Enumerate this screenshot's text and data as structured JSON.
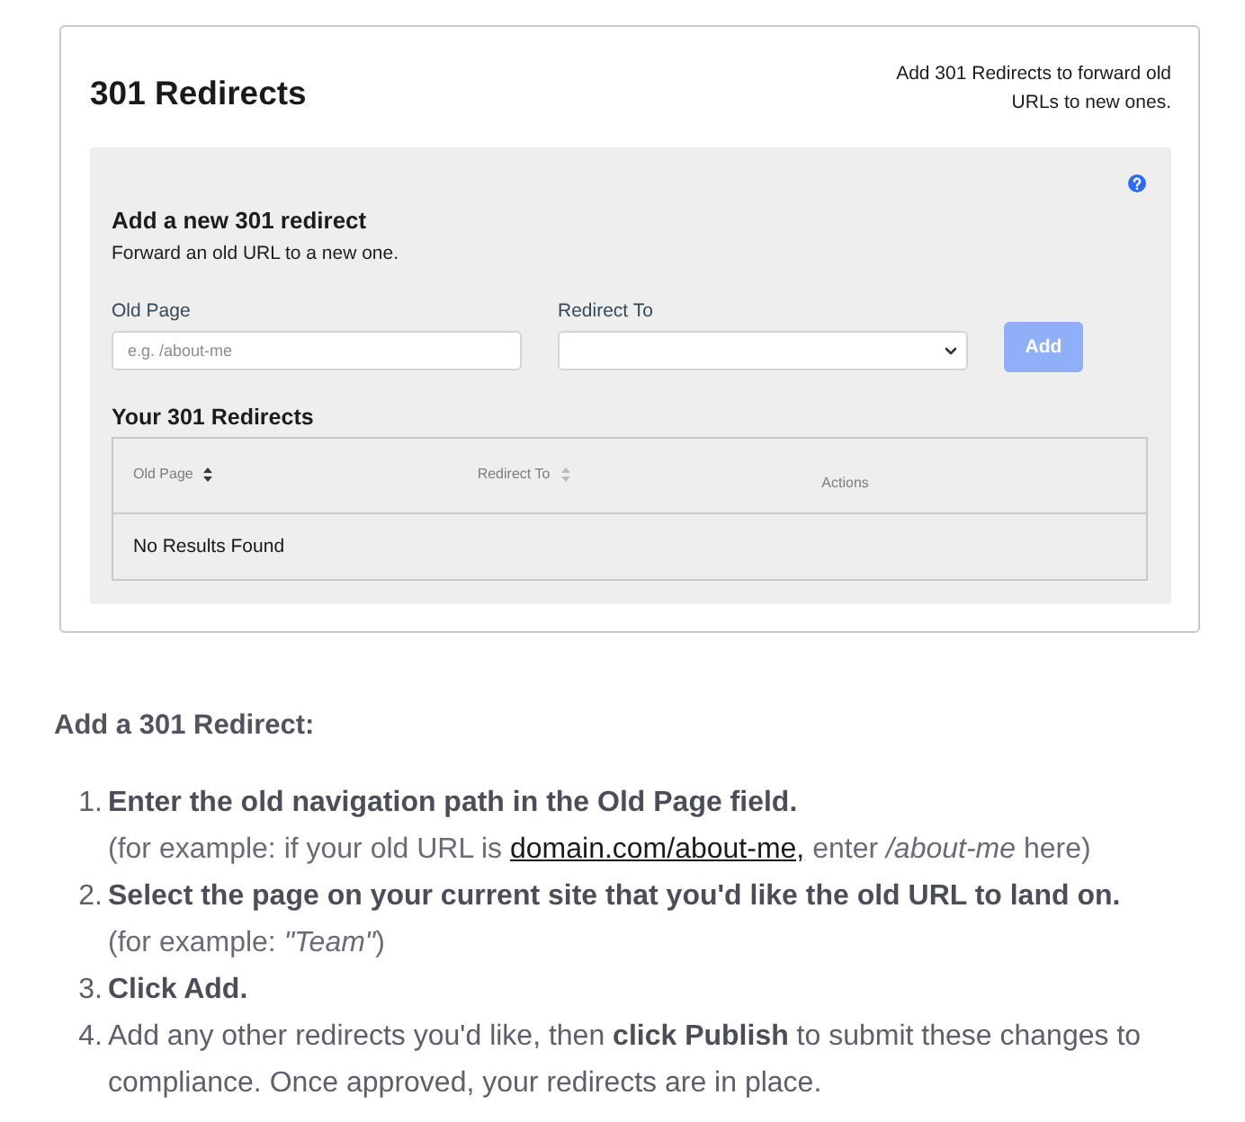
{
  "card": {
    "title": "301 Redirects",
    "description": "Add 301 Redirects to forward old URLs to new ones.",
    "form": {
      "heading": "Add a new 301 redirect",
      "subheading": "Forward an old URL to a new one.",
      "old_page": {
        "label": "Old Page",
        "placeholder": "e.g. /about-me"
      },
      "redirect_to": {
        "label": "Redirect To"
      },
      "add_button": {
        "label": "Add",
        "disabled": true
      }
    },
    "redirects": {
      "heading": "Your 301 Redirects",
      "columns": [
        {
          "label": "Old Page",
          "sortable": true,
          "sorted": true
        },
        {
          "label": "Redirect To",
          "sortable": true,
          "sorted": false
        },
        {
          "label": "Actions",
          "sortable": false
        }
      ],
      "empty_message": "No Results Found"
    }
  },
  "instructions": {
    "heading": "Add a 301 Redirect:",
    "steps": [
      {
        "number": "1.",
        "text": "Enter the old navigation path in the Old Page field.",
        "bold": true,
        "note": [
          {
            "kind": "text",
            "text": "(for example: if your old URL is "
          },
          {
            "kind": "link",
            "text": "domain.com/about-me,"
          },
          {
            "kind": "text",
            "text": " enter */about-me* here)"
          }
        ]
      },
      {
        "number": "2.",
        "text": "Select the page on your current site that you'd like the old URL to land on.",
        "bold": true,
        "note": [
          {
            "kind": "text",
            "text": "(for example: *\"Team\"*)"
          }
        ]
      },
      {
        "number": "3.",
        "text": "Click Add.",
        "bold": true
      },
      {
        "number": "4.",
        "text": "Add any other redirects you'd like, then **click Publish** to submit these changes to compliance. Once approved, your redirects are in place.",
        "bold": false
      }
    ]
  }
}
